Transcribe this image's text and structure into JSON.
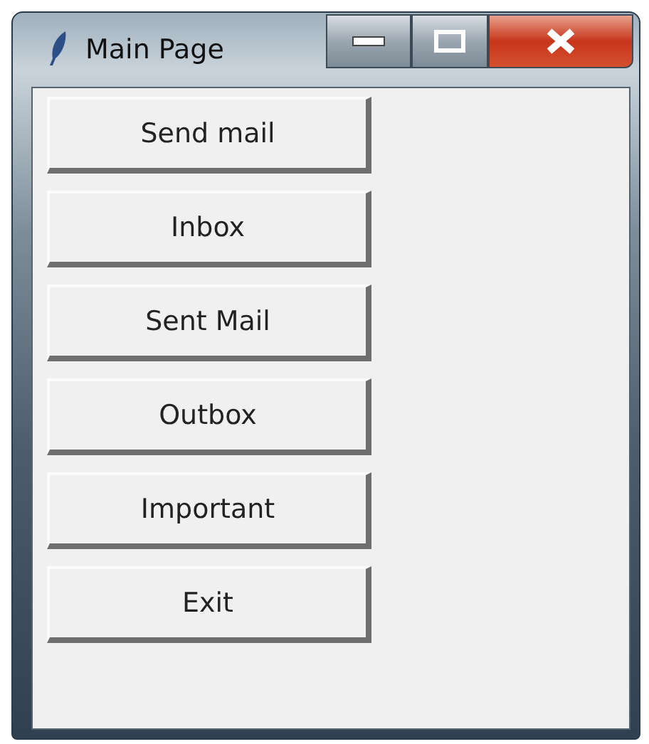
{
  "window": {
    "title": "Main Page"
  },
  "buttons": [
    {
      "label": "Send mail"
    },
    {
      "label": "Inbox"
    },
    {
      "label": "Sent Mail"
    },
    {
      "label": "Outbox"
    },
    {
      "label": "Important"
    },
    {
      "label": "Exit"
    }
  ]
}
